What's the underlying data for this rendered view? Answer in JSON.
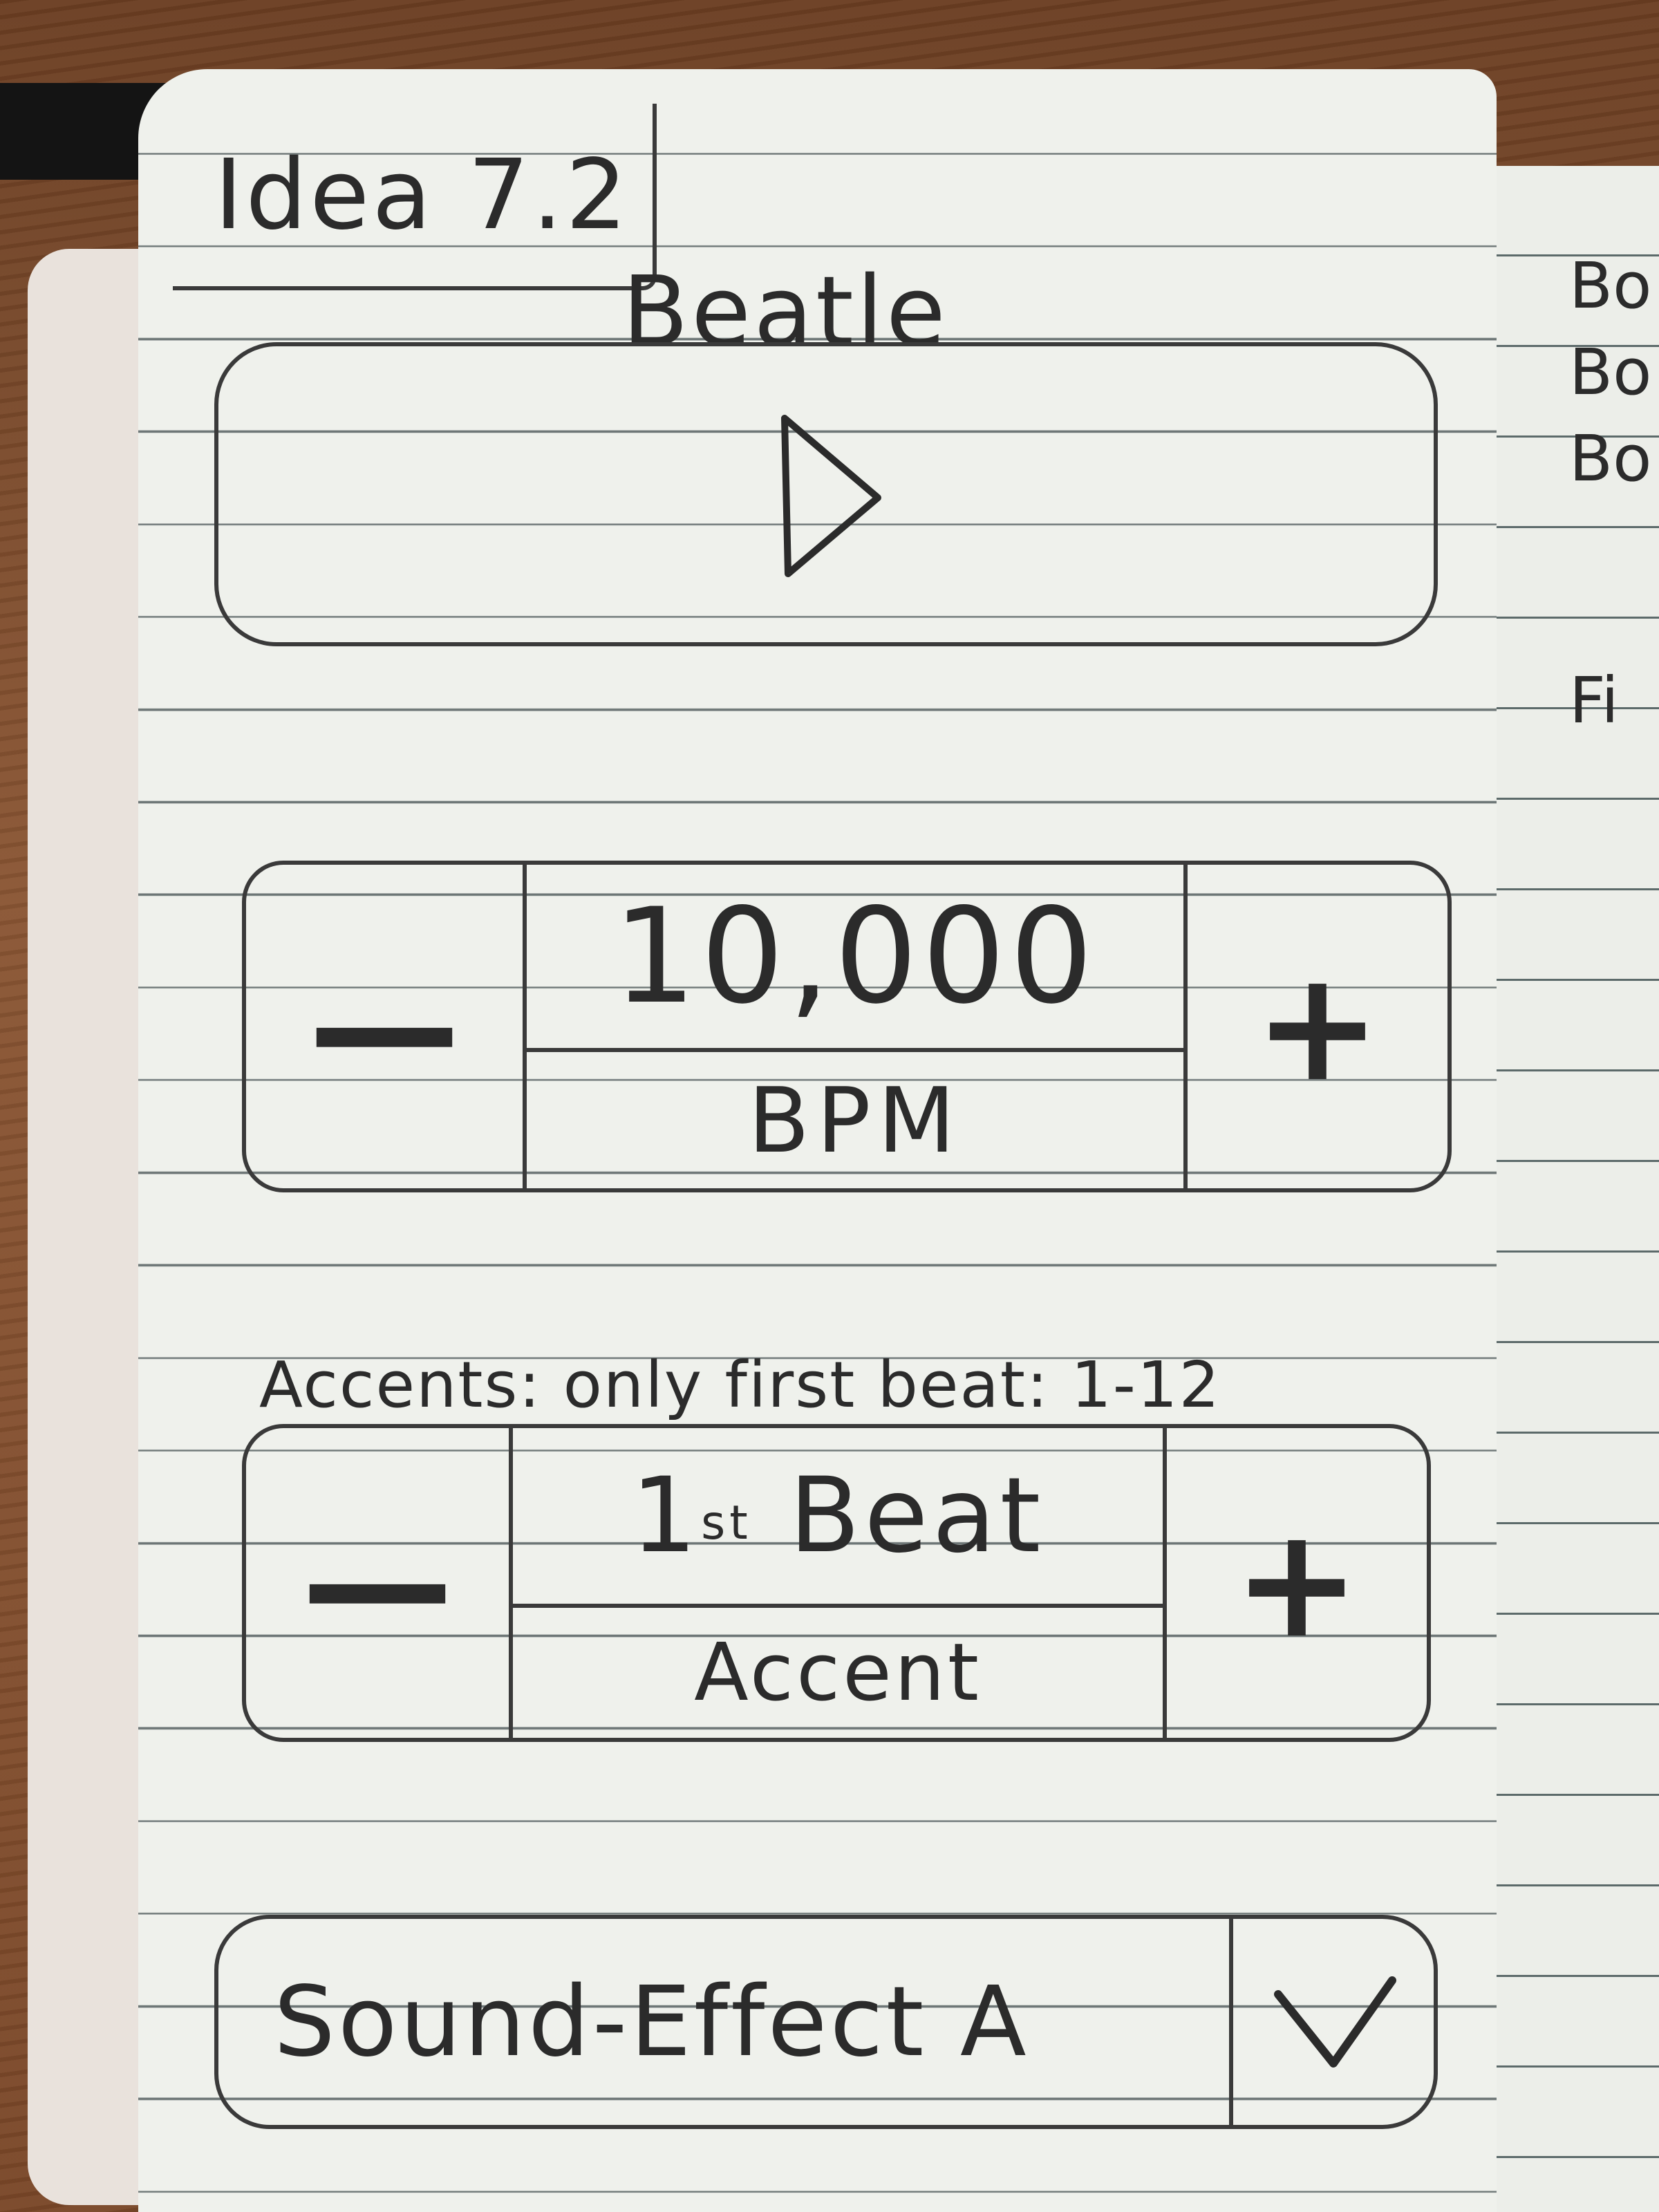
{
  "sketch": {
    "page_label": "Idea 7.2",
    "app_title": "Beatle",
    "play_icon": "play-triangle-icon",
    "tempo": {
      "value": "10,000",
      "unit": "BPM",
      "decrement_label": "—",
      "increment_label": "+"
    },
    "accents_note": "Accents: only first beat: 1-12",
    "accent": {
      "value_ordinal": "1",
      "value_suffix": "st",
      "value_word": "Beat",
      "label": "Accent",
      "decrement_label": "—",
      "increment_label": "+"
    },
    "sound": {
      "selected": "Sound-Effect A",
      "toggle_icon": "chevron-down-icon"
    }
  },
  "right_page": {
    "lines": [
      "Bo",
      "Bo",
      "Bo",
      "Fi"
    ]
  }
}
